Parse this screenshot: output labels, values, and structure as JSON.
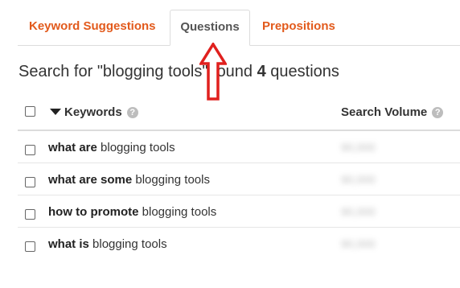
{
  "tabs": [
    {
      "label": "Keyword Suggestions"
    },
    {
      "label": "Questions"
    },
    {
      "label": "Prepositions"
    }
  ],
  "heading": {
    "prefix": "Search for \"blogging tools\" found ",
    "count": "4",
    "suffix": " questions"
  },
  "table": {
    "headers": {
      "keywords": "Keywords",
      "volume": "Search Volume"
    },
    "help_glyph": "?",
    "rows": [
      {
        "bold": "what are",
        "rest": " blogging tools",
        "volume": "90,000"
      },
      {
        "bold": "what are some",
        "rest": " blogging tools",
        "volume": "90,000"
      },
      {
        "bold": "how to promote",
        "rest": " blogging tools",
        "volume": "90,000"
      },
      {
        "bold": "what is",
        "rest": " blogging tools",
        "volume": "90,000"
      }
    ]
  },
  "colors": {
    "accent": "#e25a1c",
    "arrow": "#e0201e"
  }
}
